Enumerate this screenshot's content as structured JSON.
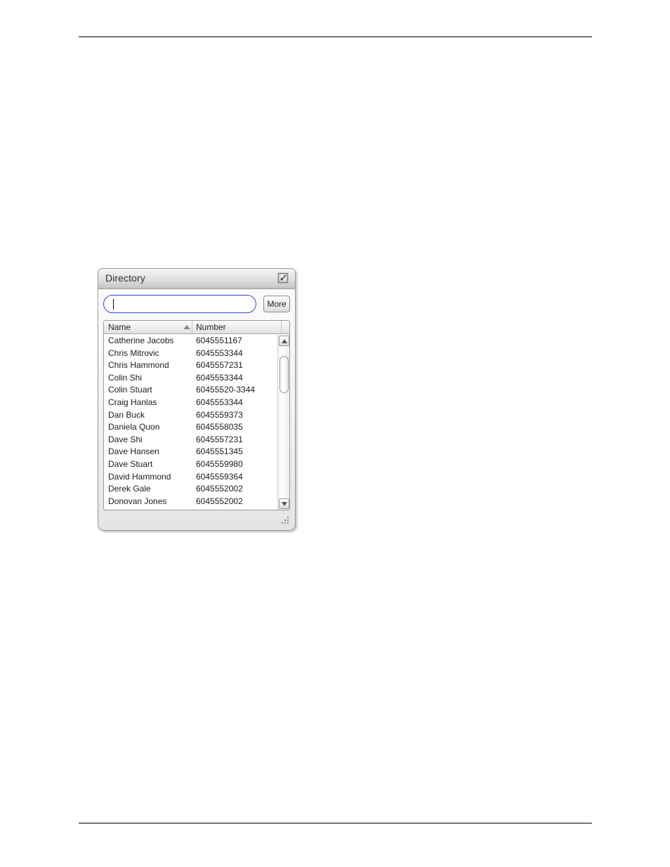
{
  "page": {
    "rules": {
      "top_label": "header-rule",
      "bottom_label": "footer-rule"
    }
  },
  "window": {
    "title": "Directory",
    "title_button_icon": "restore-window-icon",
    "resize_grip_icon": "resize-grip-icon"
  },
  "search": {
    "value": "",
    "placeholder": "",
    "more_label": "More"
  },
  "table": {
    "columns": [
      {
        "key": "name",
        "label": "Name",
        "sorted": "ascending",
        "sort_icon": "sort-ascending-icon"
      },
      {
        "key": "number",
        "label": "Number",
        "sorted": "none"
      }
    ],
    "rows": [
      {
        "name": "Catherine Jacobs",
        "number": "6045551167"
      },
      {
        "name": "Chris  Mitrovic",
        "number": "6045553344"
      },
      {
        "name": "Chris Hammond",
        "number": "6045557231"
      },
      {
        "name": "Colin Shi",
        "number": "6045553344"
      },
      {
        "name": "Colin Stuart",
        "number": "60455520-3344"
      },
      {
        "name": "Craig Hanlas",
        "number": "6045553344"
      },
      {
        "name": "Dan Buck",
        "number": "6045559373"
      },
      {
        "name": "Daniela Quon",
        "number": "6045558035"
      },
      {
        "name": "Dave Shi",
        "number": "6045557231"
      },
      {
        "name": "Dave Hansen",
        "number": "6045551345"
      },
      {
        "name": "Dave Stuart",
        "number": "6045559980"
      },
      {
        "name": "David Hammond",
        "number": "6045559364"
      },
      {
        "name": "Derek Gale",
        "number": "6045552002"
      },
      {
        "name": "Donovan Jones",
        "number": "6045552002"
      }
    ]
  },
  "scrollbar": {
    "up_icon": "scroll-up-arrow-icon",
    "down_icon": "scroll-down-arrow-icon",
    "thumb_label": "scrollbar-thumb"
  },
  "colors": {
    "search_border": "#3a44c8",
    "window_border": "#9a9a9a",
    "text": "#1b1b1b"
  }
}
